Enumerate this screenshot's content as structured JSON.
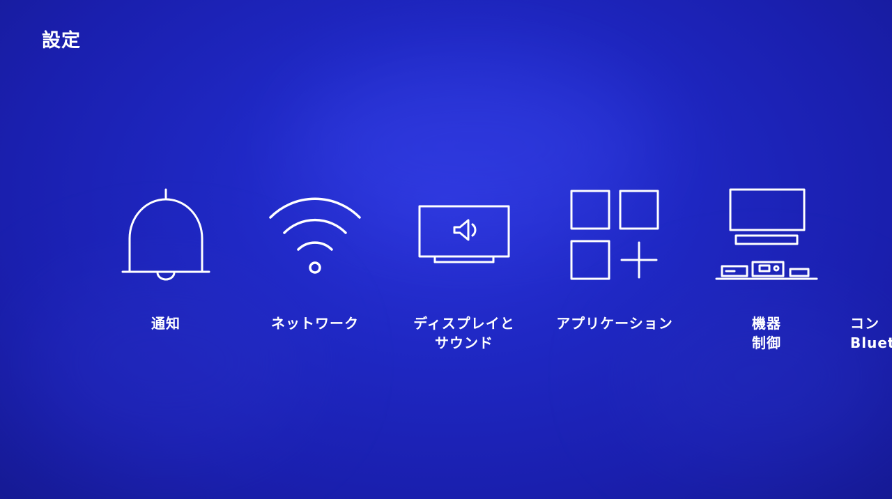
{
  "header": {
    "title": "設定"
  },
  "menu": {
    "items": [
      {
        "id": "notifications",
        "icon": "bell-icon",
        "label_line1": "通知",
        "label_line2": ""
      },
      {
        "id": "network",
        "icon": "wifi-icon",
        "label_line1": "ネットワーク",
        "label_line2": ""
      },
      {
        "id": "display-sound",
        "icon": "tv-speaker-icon",
        "label_line1": "ディスプレイと",
        "label_line2": "サウンド"
      },
      {
        "id": "applications",
        "icon": "apps-grid-icon",
        "label_line1": "アプリケーション",
        "label_line2": ""
      },
      {
        "id": "device-control",
        "icon": "home-theater-icon",
        "label_line1": "機器",
        "label_line2": "制御"
      },
      {
        "id": "controllers-bluetooth",
        "icon": "controller-icon",
        "label_line1": "コン",
        "label_line2": "Bluet"
      }
    ]
  },
  "colors": {
    "background": "#1f28c4",
    "foreground": "#ffffff"
  }
}
